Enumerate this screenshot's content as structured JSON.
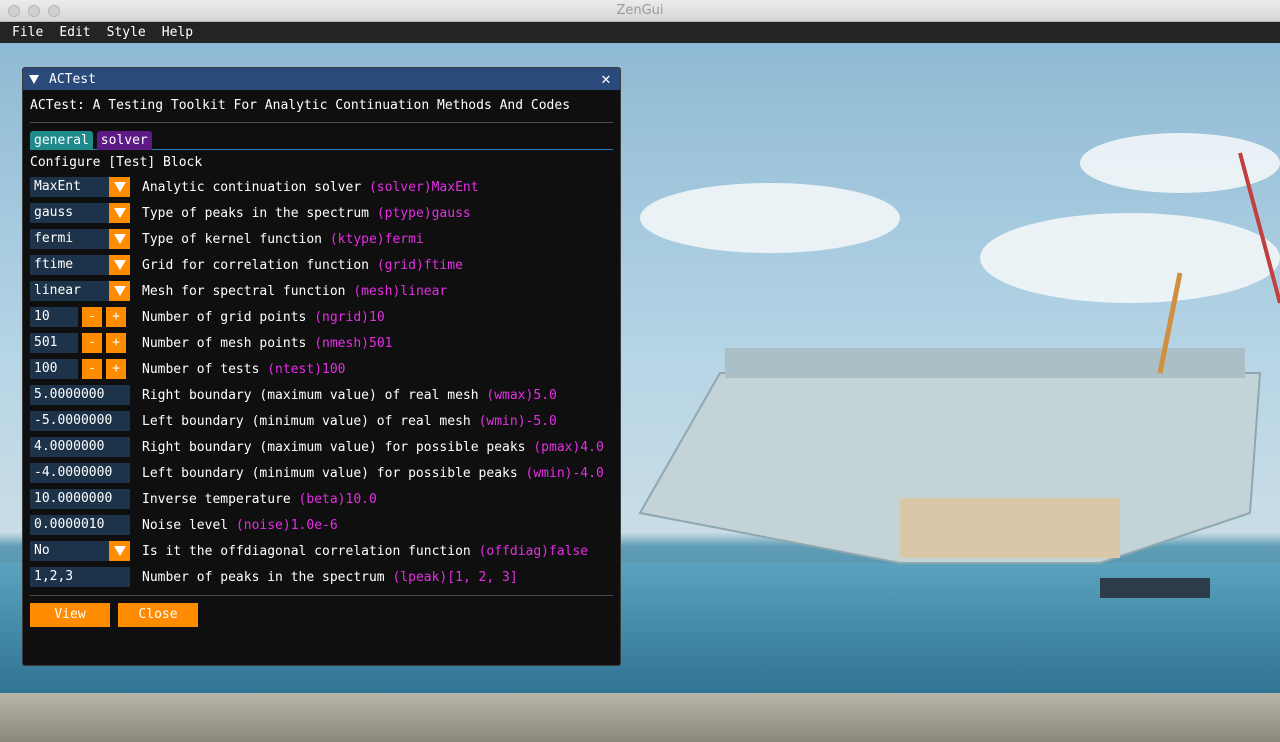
{
  "window": {
    "title": "ZenGui"
  },
  "menu": [
    "File",
    "Edit",
    "Style",
    "Help"
  ],
  "panel": {
    "title": "ACTest",
    "close_glyph": "✕",
    "heading": "ACTest: A Testing Toolkit For Analytic Continuation Methods And Codes",
    "tabs": [
      {
        "label": "general"
      },
      {
        "label": "solver"
      }
    ],
    "block_title": "Configure [Test] Block",
    "rows": [
      {
        "kind": "combo",
        "value": "MaxEnt",
        "desc": "Analytic continuation solver",
        "tag": "(solver)MaxEnt"
      },
      {
        "kind": "combo",
        "value": "gauss",
        "desc": "Type of peaks in the spectrum",
        "tag": "(ptype)gauss"
      },
      {
        "kind": "combo",
        "value": "fermi",
        "desc": "Type of kernel function",
        "tag": "(ktype)fermi"
      },
      {
        "kind": "combo",
        "value": "ftime",
        "desc": "Grid for correlation function",
        "tag": "(grid)ftime"
      },
      {
        "kind": "combo",
        "value": "linear",
        "desc": "Mesh for spectral function",
        "tag": "(mesh)linear"
      },
      {
        "kind": "int",
        "value": "10",
        "desc": "Number of grid points",
        "tag": "(ngrid)10"
      },
      {
        "kind": "int",
        "value": "501",
        "desc": "Number of mesh points",
        "tag": "(nmesh)501"
      },
      {
        "kind": "int",
        "value": "100",
        "desc": "Number of tests",
        "tag": "(ntest)100"
      },
      {
        "kind": "input",
        "value": "5.0000000",
        "desc": "Right boundary (maximum value) of real mesh",
        "tag": "(wmax)5.0"
      },
      {
        "kind": "input",
        "value": "-5.0000000",
        "desc": "Left boundary (minimum value) of real mesh",
        "tag": "(wmin)-5.0"
      },
      {
        "kind": "input",
        "value": "4.0000000",
        "desc": "Right boundary (maximum value) for possible peaks",
        "tag": "(pmax)4.0"
      },
      {
        "kind": "input",
        "value": "-4.0000000",
        "desc": "Left boundary (minimum value) for possible peaks",
        "tag": "(wmin)-4.0"
      },
      {
        "kind": "input",
        "value": "10.0000000",
        "desc": "Inverse temperature",
        "tag": "(beta)10.0"
      },
      {
        "kind": "input",
        "value": "0.0000010",
        "desc": "Noise level",
        "tag": "(noise)1.0e-6"
      },
      {
        "kind": "combo",
        "value": "No",
        "desc": "Is it the offdiagonal correlation function",
        "tag": "(offdiag)false"
      },
      {
        "kind": "input",
        "value": "1,2,3",
        "desc": "Number of peaks in the spectrum",
        "tag": "(lpeak)[1, 2, 3]"
      }
    ],
    "buttons": {
      "view": "View",
      "close": "Close"
    },
    "stepper": {
      "minus": "-",
      "plus": "+"
    }
  },
  "colors": {
    "accent": "#ff8c00",
    "tag": "#e52ee5",
    "frame": "#1d3349",
    "title_bar": "#294a7a",
    "tab_active": "#1e8a8c",
    "tab_inactive": "#5d1a85",
    "panel_bg": "#0f0f0f"
  }
}
